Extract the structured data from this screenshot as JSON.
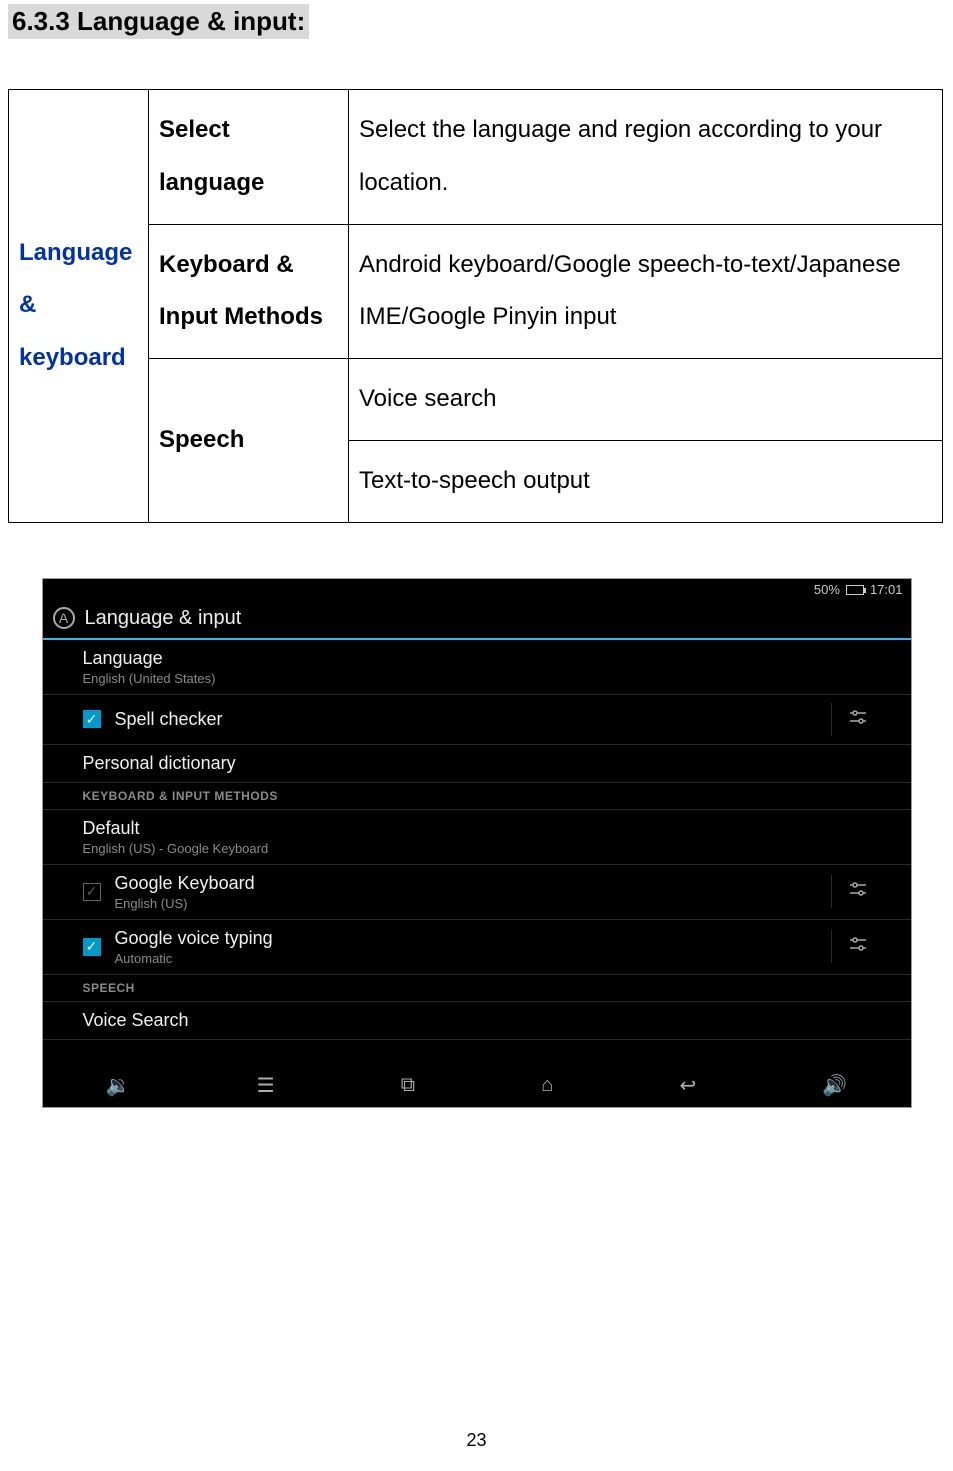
{
  "heading": "6.3.3 Language & input:",
  "table": {
    "category": "Language & keyboard",
    "rows": [
      {
        "setting": "Select language",
        "desc": "Select the language and region according to your location."
      },
      {
        "setting": "Keyboard & Input Methods",
        "desc": "Android keyboard/Google speech-to-text/Japanese IME/Google Pinyin input"
      },
      {
        "setting": "Speech",
        "desc_a": "Voice search",
        "desc_b": "Text-to-speech output"
      }
    ]
  },
  "android": {
    "status": {
      "battery_text": "50%",
      "time": "17:01"
    },
    "title": "Language & input",
    "items": {
      "language": {
        "primary": "Language",
        "secondary": "English (United States)"
      },
      "spell_checker": {
        "primary": "Spell checker"
      },
      "personal_dict": {
        "primary": "Personal dictionary"
      },
      "section_kbd": "KEYBOARD & INPUT METHODS",
      "default": {
        "primary": "Default",
        "secondary": "English (US) - Google Keyboard"
      },
      "google_kbd": {
        "primary": "Google Keyboard",
        "secondary": "English (US)"
      },
      "google_voice": {
        "primary": "Google voice typing",
        "secondary": "Automatic"
      },
      "section_speech": "SPEECH",
      "voice_search": {
        "primary": "Voice Search"
      }
    }
  },
  "page_number": "23"
}
